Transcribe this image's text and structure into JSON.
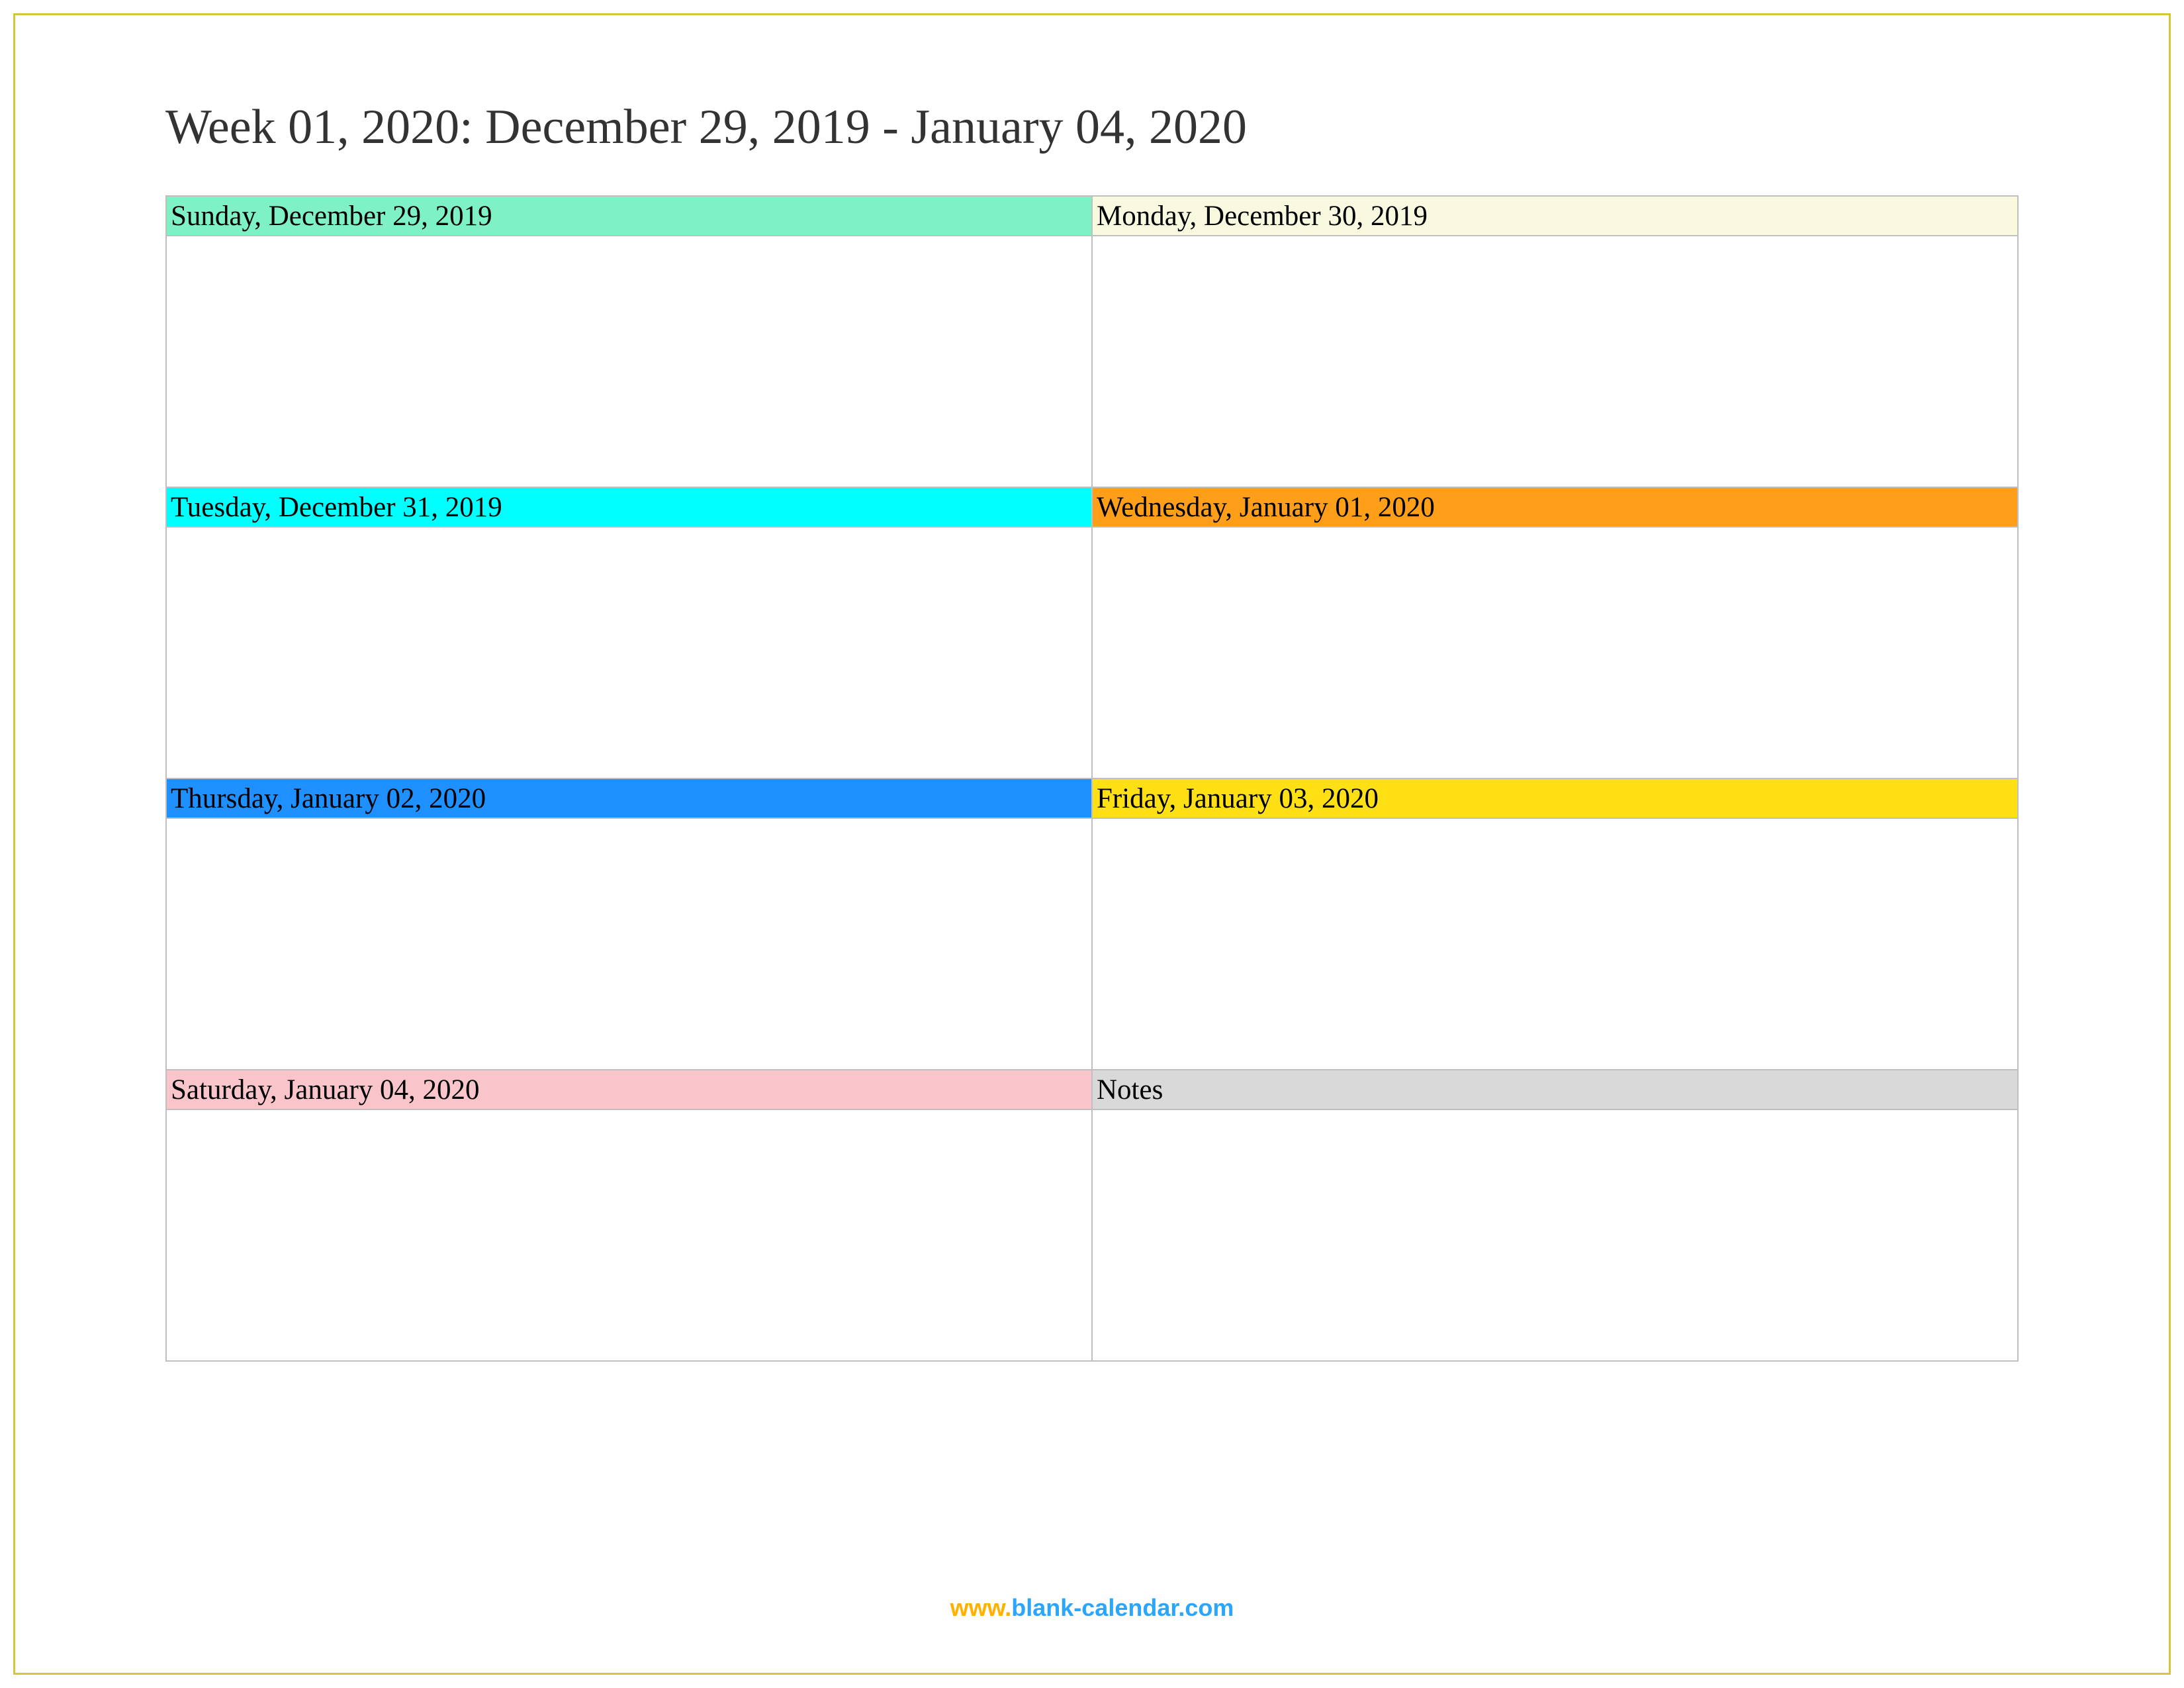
{
  "title": "Week 01, 2020: December 29, 2019 - January 04, 2020",
  "cells": {
    "sunday": {
      "label": "Sunday, December 29, 2019",
      "color": "#7ff2c5"
    },
    "monday": {
      "label": "Monday, December 30, 2019",
      "color": "#f9f9df"
    },
    "tuesday": {
      "label": "Tuesday, December 31, 2019",
      "color": "#00ffff"
    },
    "wednesday": {
      "label": "Wednesday, January 01, 2020",
      "color": "#ff9e19"
    },
    "thursday": {
      "label": "Thursday, January 02, 2020",
      "color": "#1e90ff"
    },
    "friday": {
      "label": "Friday, January 03, 2020",
      "color": "#ffe015"
    },
    "saturday": {
      "label": "Saturday, January 04, 2020",
      "color": "#fac4cb"
    },
    "notes": {
      "label": "Notes",
      "color": "#d9d9d9"
    }
  },
  "footer": {
    "www": "www.",
    "domain": "blank-calendar.com"
  }
}
